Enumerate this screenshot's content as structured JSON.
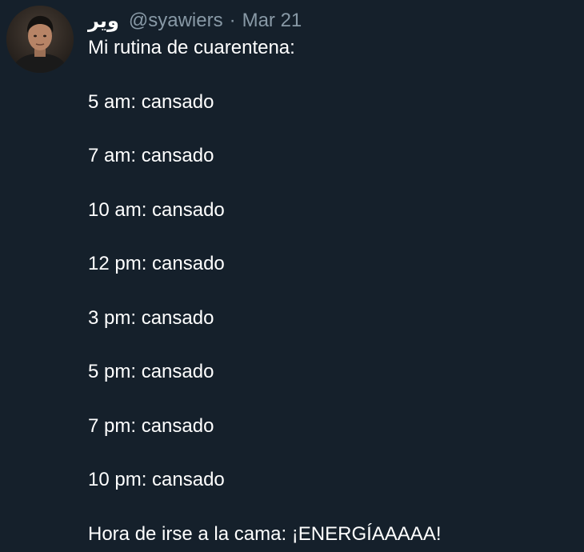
{
  "tweet": {
    "author": {
      "display_name": "ویر",
      "handle": "@syawiers",
      "separator": "·",
      "avatar_icon": "user-avatar-photo"
    },
    "date": "Mar 21",
    "lines": [
      "Mi rutina de cuarentena:",
      "5 am: cansado",
      "7 am: cansado",
      "10 am: cansado",
      "12 pm: cansado",
      "3 pm: cansado",
      "5 pm: cansado",
      "7 pm: cansado",
      "10 pm: cansado",
      "Hora de irse a la cama: ¡ENERGÍAAAAA!"
    ]
  },
  "colors": {
    "background": "#15202b",
    "text": "#ffffff",
    "secondary_text": "#8899a6"
  }
}
